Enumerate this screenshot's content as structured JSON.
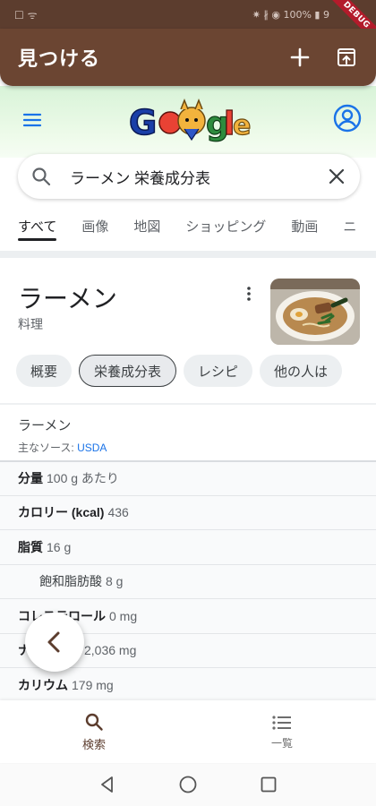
{
  "status_bar": {
    "left_icons": "☐ ᯤ",
    "right_text": "✷ ∦ ◉ 100% ▮ 9",
    "debug_label": "DEBUG"
  },
  "app_bar": {
    "title": "見つける",
    "actions": [
      "plus-icon",
      "open-in-browser-icon"
    ]
  },
  "google": {
    "logo_text": "Google",
    "search": {
      "query": "ラーメン 栄養成分表"
    },
    "tabs": [
      "すべて",
      "画像",
      "地図",
      "ショッピング",
      "動画",
      "ニ"
    ],
    "active_tab": "すべて"
  },
  "knowledge_panel": {
    "title": "ラーメン",
    "subtitle": "料理",
    "chips": [
      "概要",
      "栄養成分表",
      "レシピ",
      "他の人は"
    ],
    "selected_chip": "栄養成分表",
    "nutrition": {
      "heading": "ラーメン",
      "source_prefix": "主なソース: ",
      "source_link": "USDA",
      "rows": [
        {
          "label": "分量",
          "value": "100 g あたり"
        },
        {
          "label": "カロリー (kcal)",
          "value": "436"
        },
        {
          "label": "脂質",
          "value": "16 g"
        },
        {
          "label": "飽和脂肪酸",
          "value": "8 g"
        },
        {
          "label": "コレステロール",
          "value": "0 mg"
        },
        {
          "label": "ナトリウム",
          "value": "2,036 mg"
        },
        {
          "label": "カリウム",
          "value": "179 mg"
        }
      ]
    }
  },
  "bottom_nav": {
    "items": [
      {
        "label": "検索",
        "icon": "search-icon"
      },
      {
        "label": "一覧",
        "icon": "list-icon"
      }
    ]
  },
  "colors": {
    "app_bar": "#6b4532",
    "status_bar": "#5c3d2e",
    "link": "#1a73e8"
  }
}
